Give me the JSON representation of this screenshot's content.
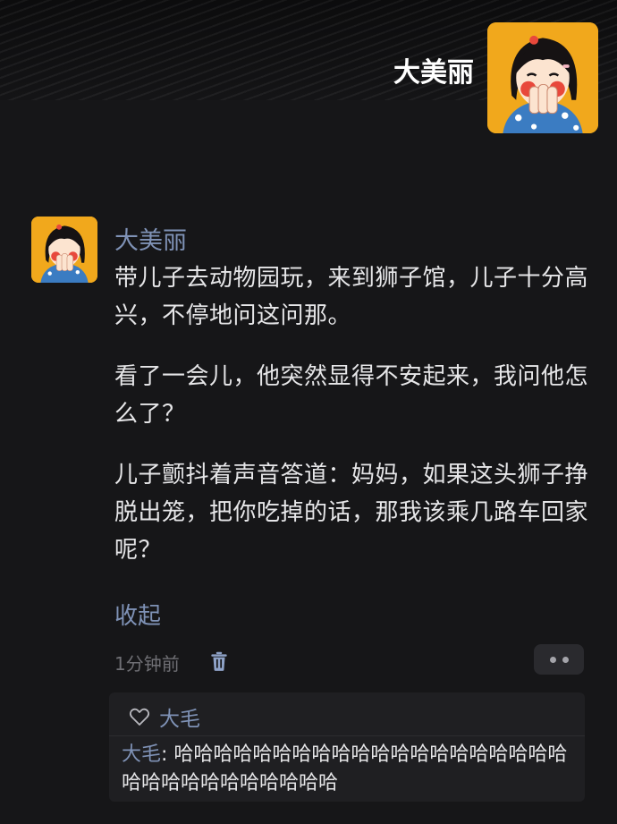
{
  "header": {
    "username": "大美丽",
    "avatar_icon": "girl-avatar-icon"
  },
  "post": {
    "author": "大美丽",
    "paragraphs": [
      "带儿子去动物园玩，来到狮子馆，儿子十分高兴，不停地问这问那。",
      "看了一会儿，他突然显得不安起来，我问他怎么了？",
      "儿子颤抖着声音答道：妈妈，如果这头狮子挣脱出笼，把你吃掉的话，那我该乘几路车回家呢？"
    ],
    "collapse_label": "收起",
    "time": "1分钟前",
    "delete_icon": "trash-icon",
    "more_icon": "more-dots-icon"
  },
  "reply": {
    "like_icon": "heart-icon",
    "liker": "大毛",
    "comment_author": "大毛",
    "comment_separator": ": ",
    "comment_text": "哈哈哈哈哈哈哈哈哈哈哈哈哈哈哈哈哈哈哈哈哈哈哈哈哈哈哈哈哈哈哈"
  },
  "colors": {
    "background": "#161618",
    "accent_name": "#7f92b6",
    "avatar_bg": "#f1a81c"
  }
}
